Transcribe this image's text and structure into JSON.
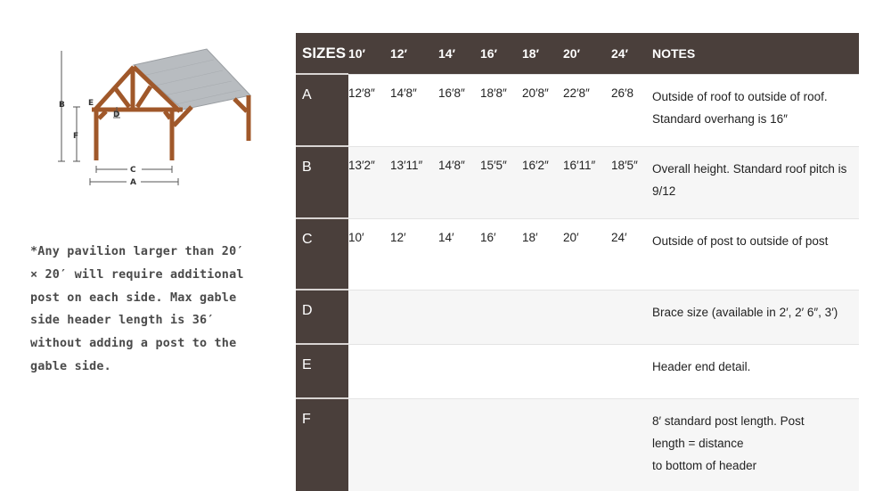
{
  "diagram": {
    "labels": {
      "A": "A",
      "B": "B",
      "C": "C",
      "D": "D",
      "E": "E",
      "F": "F"
    },
    "colors": {
      "timber": "#a0582a",
      "roof": "#b8bcc0",
      "dimension_line": "#555555"
    }
  },
  "footnote": {
    "lines": [
      "*Any pavilion larger than 20′",
      "× 20′ will require additional",
      "post on each side. Max gable",
      "side header length is 36′",
      "without adding a post to the",
      "gable side."
    ]
  },
  "table": {
    "header": {
      "sizes_label": "SIZES",
      "columns": [
        "10′",
        "12′",
        "14′",
        "16′",
        "18′",
        "20′",
        "24′"
      ],
      "notes_label": "NOTES"
    },
    "rows": [
      {
        "key": "A",
        "values": [
          "12′8″",
          "14′8″",
          "16′8″",
          "18′8″",
          "20′8″",
          "22′8″",
          "26′8"
        ],
        "note": "Outside of roof to outside of roof. Standard overhang is 16″"
      },
      {
        "key": "B",
        "values": [
          "13′2″",
          "13′11″",
          "14′8″",
          "15′5″",
          "16′2″",
          "16′11″",
          "18′5″"
        ],
        "note": "Overall height. Standard roof pitch is 9/12"
      },
      {
        "key": "C",
        "values": [
          "10′",
          "12′",
          "14′",
          "16′",
          "18′",
          "20′",
          "24′"
        ],
        "note": "Outside of post to outside of post"
      },
      {
        "key": "D",
        "values": [
          "",
          "",
          "",
          "",
          "",
          "",
          ""
        ],
        "note": "Brace size (available in 2′, 2′ 6″, 3′)"
      },
      {
        "key": "E",
        "values": [
          "",
          "",
          "",
          "",
          "",
          "",
          ""
        ],
        "note": "Header end detail."
      },
      {
        "key": "F",
        "values": [
          "",
          "",
          "",
          "",
          "",
          "",
          ""
        ],
        "note_lines": [
          "8′ standard post length. Post",
          "length = distance",
          "to bottom of header"
        ]
      }
    ],
    "colors": {
      "header_bg": "#4a3f3b",
      "row_alt_bg": "#f6f6f6"
    }
  }
}
